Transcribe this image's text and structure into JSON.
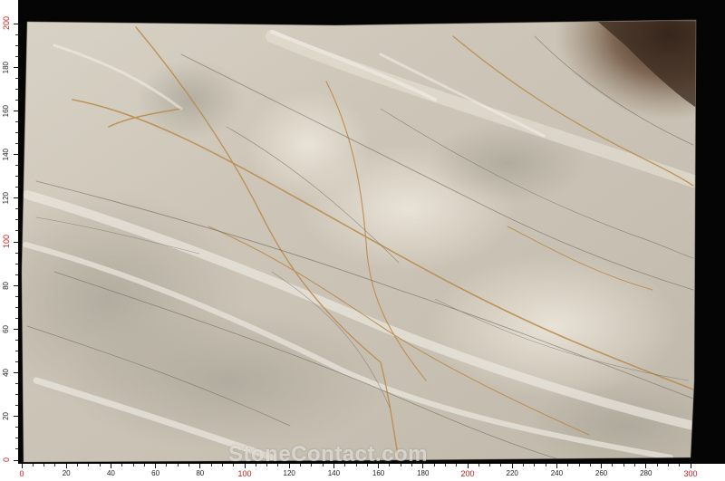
{
  "image": {
    "subject": "marble slab",
    "watermark": "StoneContact.com"
  },
  "ruler_bottom": {
    "labels": [
      "0",
      "20",
      "40",
      "60",
      "80",
      "100",
      "120",
      "140",
      "160",
      "180",
      "200",
      "220",
      "240",
      "260",
      "280",
      "300"
    ],
    "highlight": [
      "0",
      "100",
      "200",
      "300"
    ]
  },
  "ruler_left": {
    "labels": [
      "0",
      "20",
      "40",
      "60",
      "80",
      "100",
      "120",
      "140",
      "160",
      "180",
      "200"
    ],
    "highlight": [
      "0",
      "100",
      "200"
    ]
  },
  "colors": {
    "backdrop": "#050505",
    "slab_base": "#cfc8bc",
    "vein_gold": "#b88a4a",
    "vein_dark": "#6a6458",
    "corner_dark": "#3a2a20",
    "ruler_highlight": "#c81e1e"
  }
}
